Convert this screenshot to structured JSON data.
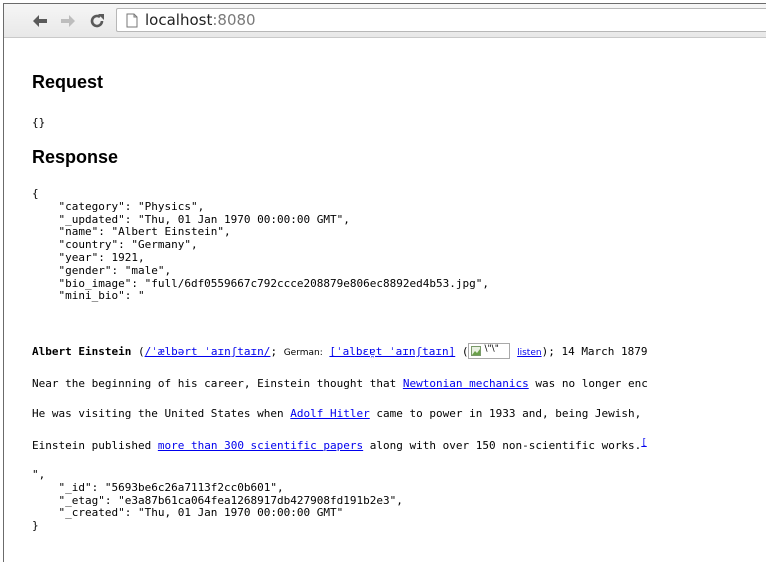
{
  "browser": {
    "url_host": "localhost",
    "url_port": ":8080"
  },
  "request": {
    "heading": "Request",
    "body": "{}"
  },
  "response": {
    "heading": "Response",
    "json_head": "{\n    \"category\": \"Physics\",\n    \"_updated\": \"Thu, 01 Jan 1970 00:00:00 GMT\",\n    \"name\": \"Albert Einstein\",\n    \"country\": \"Germany\",\n    \"year\": 1921,\n    \"gender\": \"male\",\n    \"bio_image\": \"full/6df0559667c792ccce208879e806ec8892ed4b53.jpg\",\n    \"mini_bio\": \"",
    "bio": {
      "p1": {
        "name": "Albert Einstein",
        "open_paren": " (",
        "ipa1": "/ˈælbərt ˈaɪnʃtaɪn/",
        "sep": "; ",
        "german_label": "German:",
        "ipa2": "[ˈalbɛɐ̯t ˈaɪnʃtaɪn]",
        "pre_img": " (",
        "img_alt": "\\\"\\\"",
        "listen": "listen",
        "rest": "); 14 March 1879"
      },
      "p2": {
        "before": "Near the beginning of his career, Einstein thought that ",
        "link": "Newtonian mechanics",
        "after": " was no longer enc"
      },
      "p3": {
        "before": "He was visiting the United States when ",
        "link": "Adolf Hitler",
        "after": " came to power in 1933 and, being Jewish,"
      },
      "p4": {
        "before": "Einstein published ",
        "link": "more than 300 scientific papers",
        "after": " along with over 150 non-scientific works.",
        "ref": "["
      }
    },
    "json_tail": "\",\n    \"_id\": \"5693be6c26a7113f2cc0b601\",\n    \"_etag\": \"e3a87b61ca064fea1268917db427908fd191b2e3\",\n    \"_created\": \"Thu, 01 Jan 1970 00:00:00 GMT\"\n}"
  }
}
